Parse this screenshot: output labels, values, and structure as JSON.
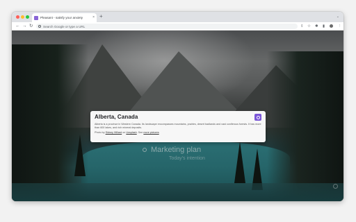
{
  "browser": {
    "tab": {
      "title": "Pleasant - satisfy your anxiety",
      "close_icon": "×"
    },
    "new_tab_icon": "+",
    "tab_menu_icon": "⌄",
    "toolbar": {
      "back_icon": "←",
      "forward_icon": "→",
      "reload_icon": "↻",
      "omnibox_placeholder": "Search Google or type a URL",
      "share_icon": "⇪",
      "bookmark_icon": "☆",
      "extensions_icon": "✱",
      "sidepanel_icon": "▮",
      "menu_icon": "⋮"
    }
  },
  "focus": {
    "title": "Marketing plan",
    "subtitle": "Today's intention"
  },
  "card": {
    "title": "Alberta, Canada",
    "description": "Alberta is a province in Western Canada. Its landscape encompasses mountains, prairies, desert badlands and vast coniferous forests. It has more than 600 lakes, and rich mineral deposits.",
    "credit_prefix": "Photo by ",
    "photographer": "Sidney Hilliard",
    "credit_on": " on ",
    "source": "Unsplash",
    "credit_sep": ". See ",
    "more_link": "more pictures"
  },
  "colors": {
    "accent": "#7b56d8"
  }
}
